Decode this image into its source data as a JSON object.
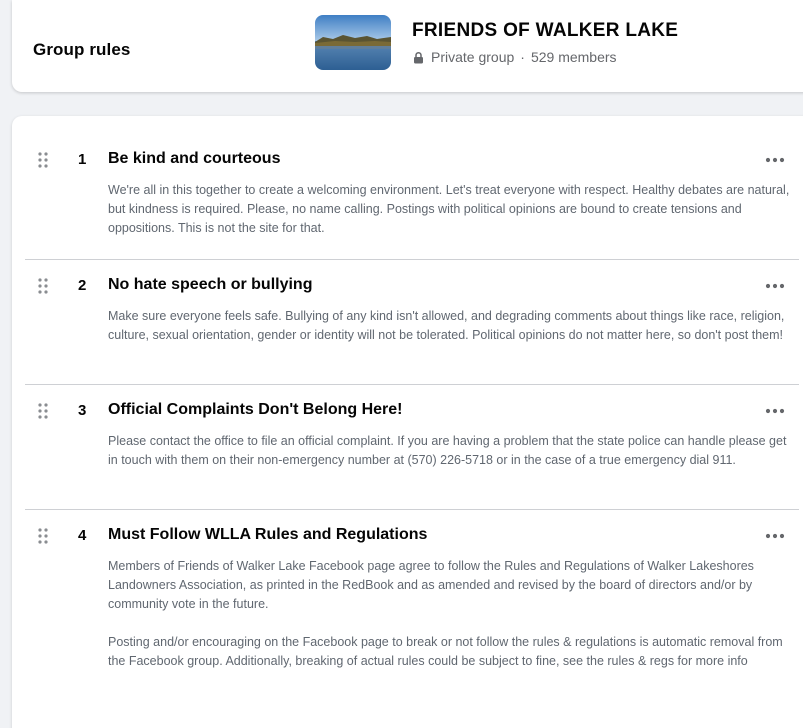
{
  "header": {
    "title": "Group rules",
    "group_name": "FRIENDS OF WALKER LAKE",
    "privacy": "Private group",
    "separator": "·",
    "members": "529 members"
  },
  "rules": [
    {
      "number": "1",
      "title": "Be kind and courteous",
      "paragraphs": [
        "We're all in this together to create a welcoming environment. Let's treat everyone with respect. Healthy debates are natural, but kindness is required. Please, no name calling. Postings with political opinions are bound to create tensions and oppositions. This is not the site for that."
      ]
    },
    {
      "number": "2",
      "title": "No hate speech or bullying",
      "paragraphs": [
        "Make sure everyone feels safe. Bullying of any kind isn't allowed, and degrading comments about things like race, religion, culture, sexual orientation, gender or identity will not be tolerated. Political opinions do not matter here, so don't post them!"
      ]
    },
    {
      "number": "3",
      "title": "Official Complaints Don't Belong Here!",
      "paragraphs": [
        "Please contact the office to file an official complaint. If you are having a problem that the state police can handle please get in touch with them on their non-emergency number at (570) 226-5718 or in the case of a true emergency dial 911."
      ]
    },
    {
      "number": "4",
      "title": "Must Follow WLLA Rules and Regulations",
      "paragraphs": [
        "Members of Friends of Walker Lake Facebook page agree to follow the Rules and Regulations of Walker Lakeshores Landowners Association, as printed in the RedBook and as amended and revised by the board of directors and/or by community vote in the future.",
        "Posting and/or encouraging on the Facebook page to break or not follow the rules & regulations is automatic removal from the Facebook group. Additionally, breaking of actual rules could be subject to fine, see the rules & regs for more info"
      ]
    }
  ],
  "icons": {
    "drag": "drag-handle-icon",
    "more": "more-options-icon",
    "lock": "lock-icon"
  }
}
